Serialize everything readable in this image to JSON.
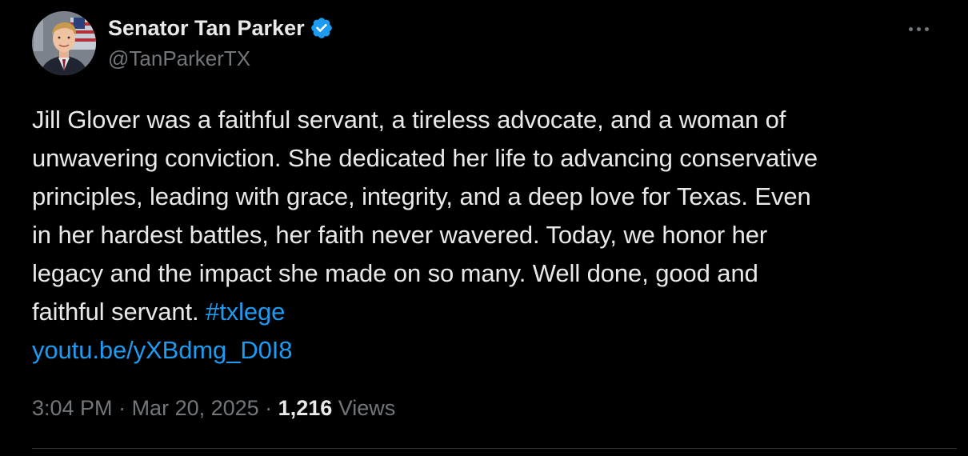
{
  "author": {
    "display_name": "Senator Tan Parker",
    "handle": "@TanParkerTX",
    "verified": true,
    "verified_color": "#1d9bf0"
  },
  "menu": {
    "icon": "more-horizontal-icon"
  },
  "tweet": {
    "lines": [
      "Jill Glover was a faithful servant, a tireless advocate, and a woman of",
      "unwavering conviction. She dedicated her life to advancing conservative",
      "principles, leading with grace, integrity, and a deep love for Texas. Even",
      "in her hardest battles, her faith never wavered. Today, we honor her",
      "legacy and the impact she made on so many. Well done, good and"
    ],
    "last_line_text": "faithful servant. ",
    "hashtag": "#txlege",
    "link": "youtu.be/yXBdmg_D0I8"
  },
  "meta": {
    "time": "3:04 PM",
    "separator": " · ",
    "date": "Mar 20, 2025",
    "views_count": "1,216",
    "views_label": "Views"
  },
  "colors": {
    "background": "#000000",
    "text_primary": "#e7e9ea",
    "text_secondary": "#71767b",
    "link": "#1d9bf0",
    "divider": "#2f3336"
  }
}
